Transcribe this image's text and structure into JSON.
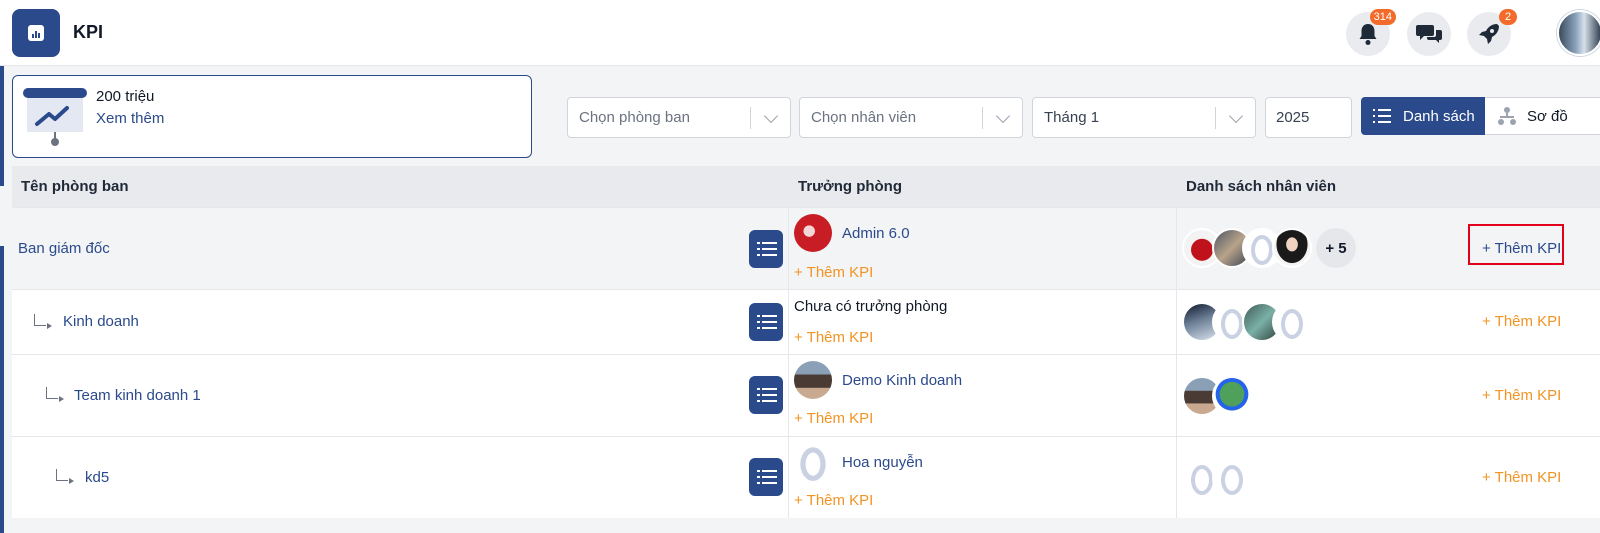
{
  "header": {
    "title": "KPI",
    "notifications_count": "314",
    "rocket_count": "2"
  },
  "kpi_card": {
    "value": "200 triệu",
    "more_link": "Xem thêm"
  },
  "filters": {
    "department_placeholder": "Chọn phòng ban",
    "employee_placeholder": "Chọn nhân viên",
    "month": "Tháng 1",
    "year": "2025",
    "view_list": "Danh sách",
    "view_tree": "Sơ đồ"
  },
  "table": {
    "columns": [
      "Tên phòng ban",
      "Trưởng phòng",
      "Danh sách nhân viên"
    ],
    "add_kpi_label": "+ Thêm KPI",
    "rows": [
      {
        "department": "Ban giám đốc",
        "manager": "Admin 6.0",
        "employees_more": "+ 5"
      },
      {
        "department": "Kinh doanh",
        "manager": "Chưa có trưởng phòng"
      },
      {
        "department": "Team kinh doanh 1",
        "manager": "Demo Kinh doanh"
      },
      {
        "department": "kd5",
        "manager": "Hoa nguyễn"
      }
    ]
  },
  "colors": {
    "primary": "#2b4a8b",
    "accent_orange": "#f29423",
    "badge": "#f26b2a",
    "highlight": "#e3001b"
  }
}
